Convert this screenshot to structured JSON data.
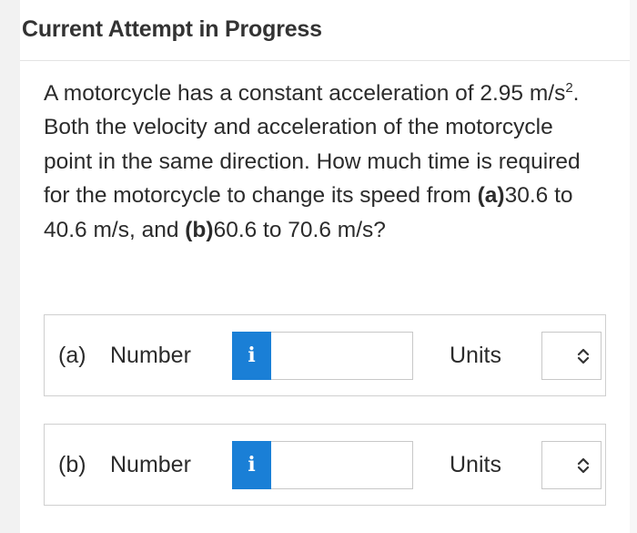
{
  "header": {
    "title": "Current Attempt in Progress"
  },
  "question": {
    "intro": "A motorcycle has a constant acceleration of 2.95 m/s",
    "sup": "2",
    "mid": ". Both the velocity and acceleration of the motorcycle point in the same direction. How much time is required for the motorcycle to change its speed from ",
    "part_a_tag": "(a)",
    "part_a_range": "30.6 to 40.6 m/s, and ",
    "part_b_tag": "(b)",
    "part_b_range": "60.6 to 70.6 m/s?"
  },
  "answers": [
    {
      "label": "(a)",
      "number_label": "Number",
      "info_icon": "i",
      "value": "",
      "units_label": "Units",
      "units_selected": ""
    },
    {
      "label": "(b)",
      "number_label": "Number",
      "info_icon": "i",
      "value": "",
      "units_label": "Units",
      "units_selected": ""
    }
  ],
  "colors": {
    "info_button": "#1a7fd6",
    "text": "#2b2b2b",
    "border": "#cfcfcf"
  }
}
